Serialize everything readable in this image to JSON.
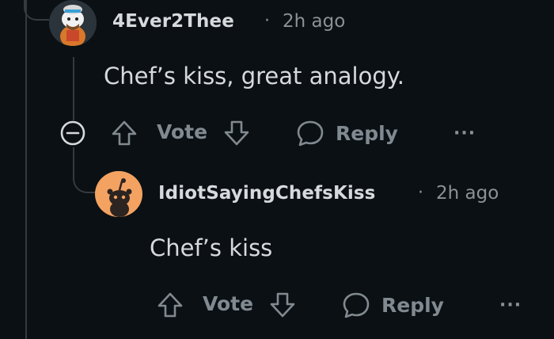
{
  "comment1": {
    "username": "4Ever2Thee",
    "separator": "·",
    "timestamp": "2h ago",
    "text": "Chef’s kiss, great analogy.",
    "vote_label": "Vote",
    "reply_label": "Reply",
    "more_label": "···"
  },
  "comment2": {
    "username": "IdiotSayingChefsKiss",
    "separator": "·",
    "timestamp": "2h ago",
    "text": "Chef’s kiss",
    "vote_label": "Vote",
    "reply_label": "Reply",
    "more_label": "···"
  },
  "colors": {
    "background": "#0b1014",
    "text": "#d7dadc",
    "muted": "#8a9297",
    "thread_line": "#343a3f",
    "avatar2_bg": "#f4a261"
  },
  "icons": {
    "collapse": "minus-circle-icon",
    "upvote": "arrow-up-icon",
    "downvote": "arrow-down-icon",
    "reply": "speech-bubble-icon",
    "more": "ellipsis-icon"
  }
}
